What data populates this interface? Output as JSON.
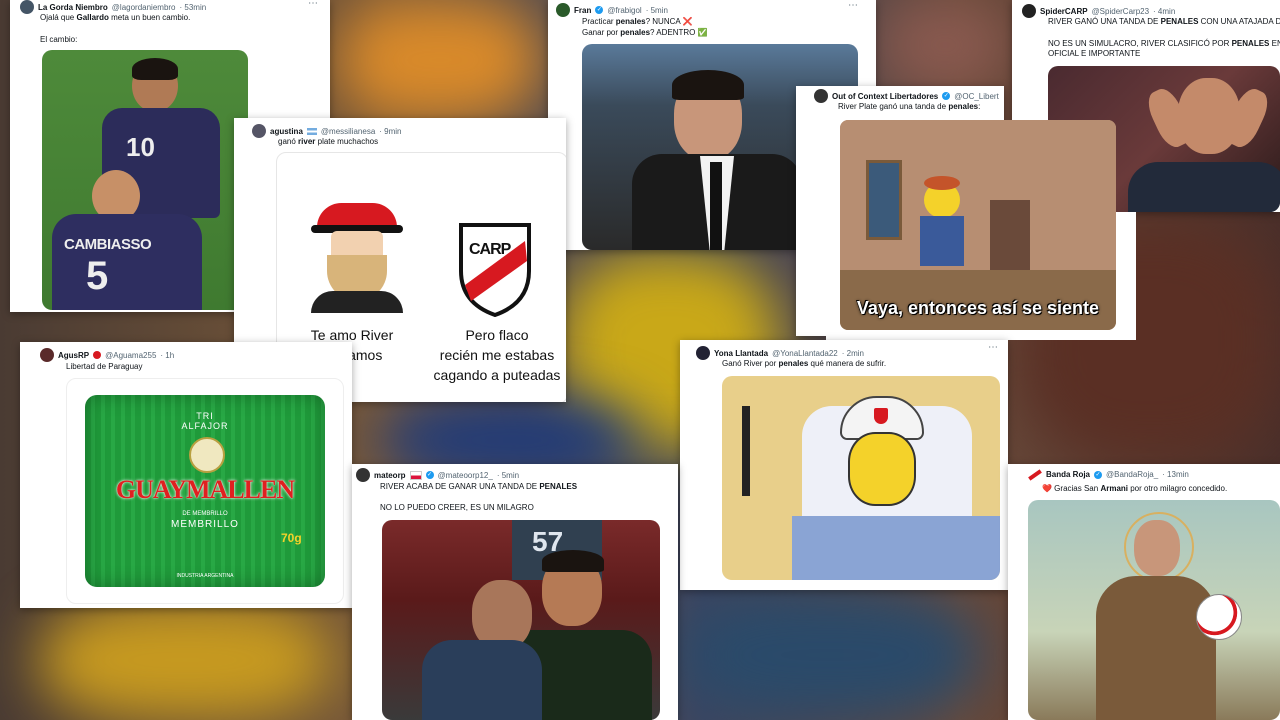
{
  "tweets": {
    "gorda": {
      "name": "La Gorda Niembro",
      "handle": "@lagordaniembro",
      "time": "· 53min",
      "line1_pre": "Ojalá que ",
      "line1_bold": "Gallardo",
      "line1_post": " meta un buen cambio.",
      "line2": "El cambio:",
      "jersey_number_10": "10",
      "back_name": "CAMBIASSO",
      "back_number": "5"
    },
    "agustina": {
      "name": "agustina",
      "handle": "@messilianesa",
      "time": "· 9min",
      "line1_pre": "ganó ",
      "line1_bold": "river",
      "line1_post": " plate muchachos",
      "caption_left": [
        "Te amo River",
        "Ganamos"
      ],
      "caption_right": [
        "Pero flaco",
        "recién me estabas",
        "cagando a puteadas"
      ],
      "crest_text": "CARP"
    },
    "fran": {
      "name": "Fran",
      "handle": "@frabigol",
      "time": "· 5min",
      "line1_pre": "Practicar ",
      "line1_bold": "penales",
      "line1_post": "? NUNCA ❌",
      "line2_pre": "Ganar por ",
      "line2_bold": "penales",
      "line2_post": "? ADENTRO ✅"
    },
    "ooc": {
      "name": "Out of Context Libertadores",
      "handle": "@OC_Libert",
      "line1_pre": "River Plate ganó una tanda de ",
      "line1_bold": "penales",
      "line1_post": ":",
      "caption": "Vaya, entonces así se siente"
    },
    "spider": {
      "name": "SpiderCARP",
      "handle": "@SpiderCarp23",
      "time": "· 4min",
      "line1_pre": "RIVER GANÓ UNA TANDA DE ",
      "line1_bold": "PENALES",
      "line1_post": " CON UNA ATAJADA DE",
      "line2_pre": "NO ES UN SIMULACRO, RIVER CLASIFICÓ POR ",
      "line2_bold": "PENALES",
      "line2_post": " EN U",
      "line3": "OFICIAL E IMPORTANTE"
    },
    "agusrp": {
      "name": "AgusRP",
      "handle": "@Aguama255",
      "time": "· 1h",
      "line1": "Libertad de Paraguay",
      "pkg_top1": "TRI",
      "pkg_top2": "ALFAJOR",
      "pkg_brand": "GUAYMALLEN",
      "pkg_sub1": "DE MEMBRILLO",
      "pkg_sub2": "MEMBRILLO",
      "pkg_weight": "70g",
      "pkg_origin": "INDUSTRIA ARGENTINA"
    },
    "mateorp": {
      "name": "mateorp",
      "handle": "@mateoorp12_",
      "time": "· 5min",
      "line1_pre": "RIVER ACABA DE GANAR UNA TANDA DE ",
      "line1_bold": "PENALES",
      "line2": "NO LO PUEDO CREER, ES UN MILAGRO",
      "shirt_number": "57"
    },
    "yona": {
      "name": "Yona Llantada",
      "handle": "@YonaLlantada22",
      "time": "· 2min",
      "line1_pre": "Ganó River por ",
      "line1_bold": "penales",
      "line1_post": " qué manera de sufrir."
    },
    "banda": {
      "name": "Banda Roja",
      "handle": "@BandaRoja_",
      "time": "· 13min",
      "line1_pre": "❤️ Gracias San ",
      "line1_bold": "Armani",
      "line1_post": " por otro milagro concedido."
    }
  },
  "colors": {
    "river_red": "#d71920",
    "alfajor_green": "#1f9a3a",
    "simpsons_yellow": "#f4d22a",
    "verified_blue": "#1d9bf0"
  }
}
